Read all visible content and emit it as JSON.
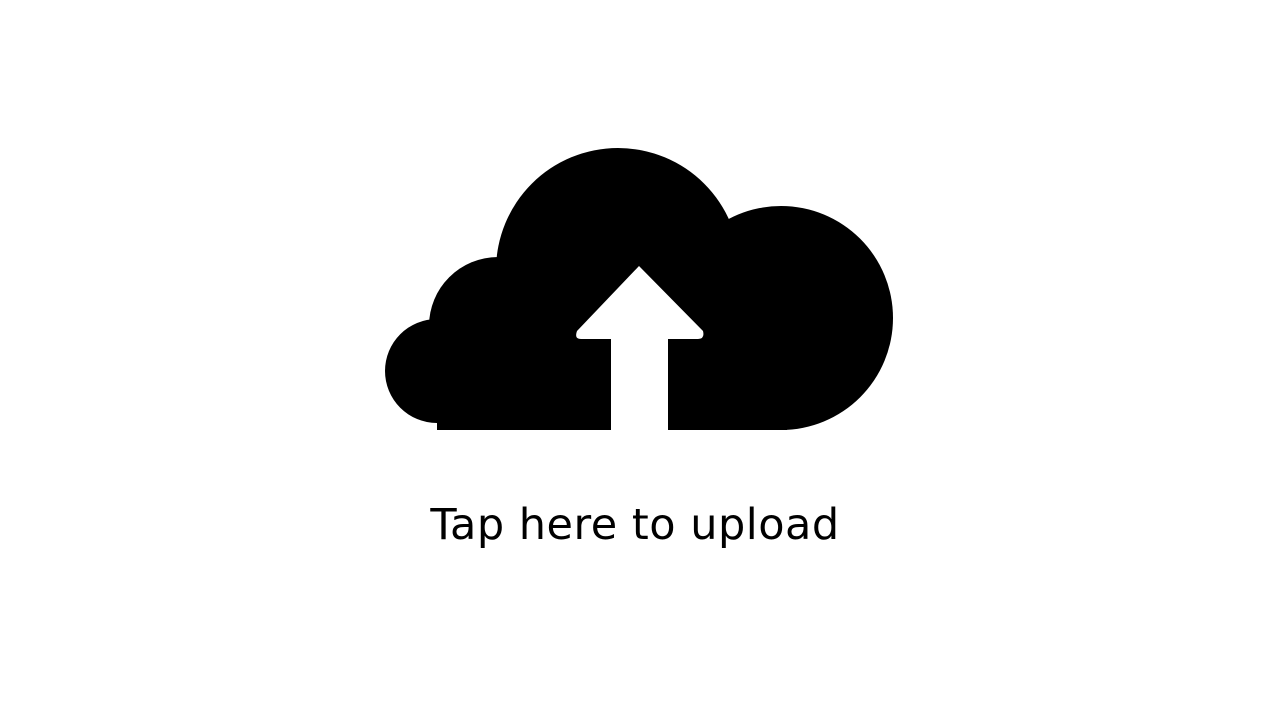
{
  "upload": {
    "icon": "cloud-upload-icon",
    "label": "Tap here to upload"
  },
  "colors": {
    "background": "#ffffff",
    "icon": "#000000",
    "text": "#000000"
  }
}
